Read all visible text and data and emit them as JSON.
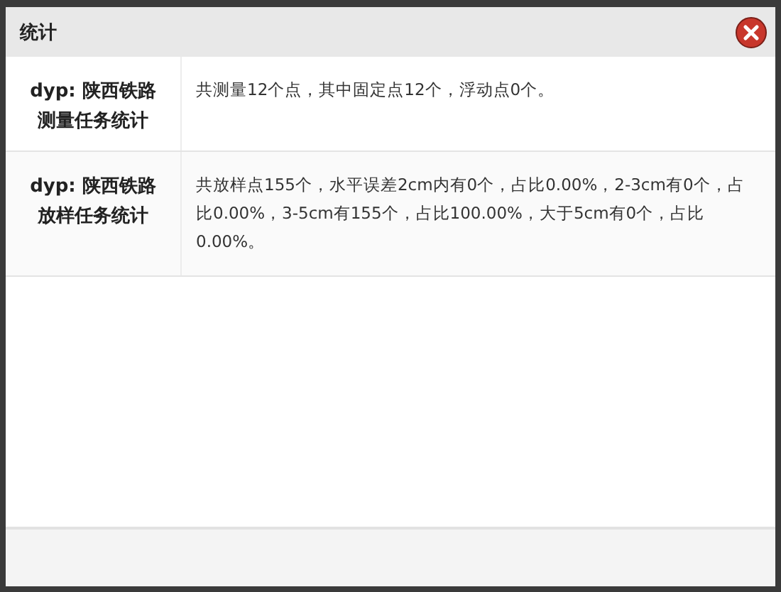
{
  "window": {
    "title": "统计"
  },
  "rows": [
    {
      "label": "dyp: 陕西铁路测量任务统计",
      "text": "共测量12个点，其中固定点12个，浮动点0个。"
    },
    {
      "label": "dyp: 陕西铁路放样任务统计",
      "text": "共放样点155个，水平误差2cm内有0个，占比0.00%，2-3cm有0个，占比0.00%，3-5cm有155个，占比100.00%，大于5cm有0个，占比0.00%。"
    }
  ]
}
